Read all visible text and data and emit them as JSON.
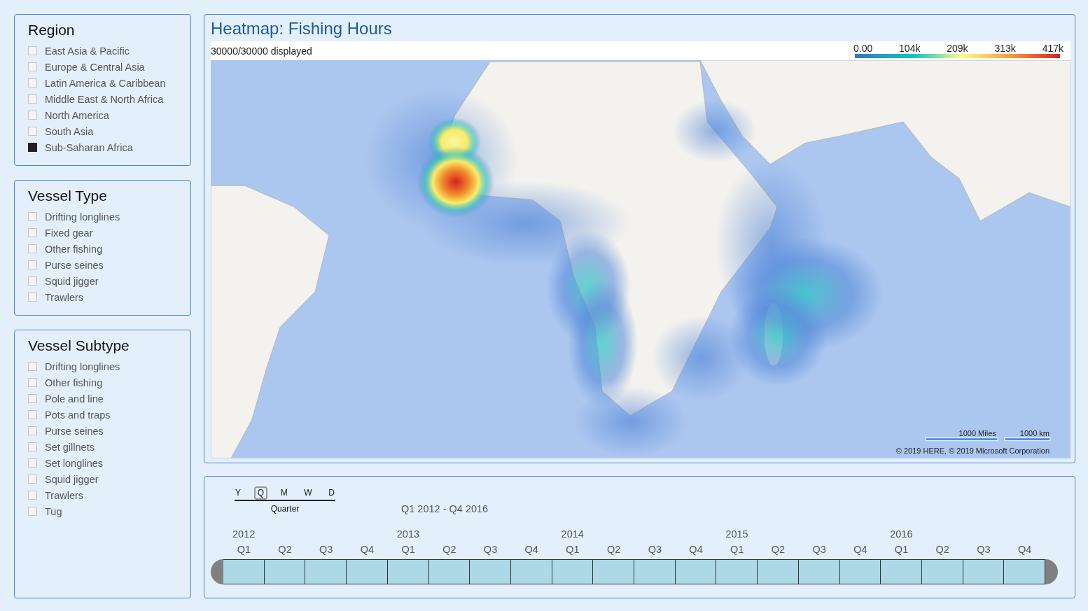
{
  "filters": [
    {
      "title": "Region",
      "items": [
        {
          "label": "East Asia & Pacific",
          "checked": false
        },
        {
          "label": "Europe & Central Asia",
          "checked": false
        },
        {
          "label": "Latin America & Caribbean",
          "checked": false
        },
        {
          "label": "Middle East & North Africa",
          "checked": false
        },
        {
          "label": "North America",
          "checked": false
        },
        {
          "label": "South Asia",
          "checked": false
        },
        {
          "label": "Sub-Saharan Africa",
          "checked": true
        }
      ]
    },
    {
      "title": "Vessel Type",
      "items": [
        {
          "label": "Drifting longlines",
          "checked": false
        },
        {
          "label": "Fixed gear",
          "checked": false
        },
        {
          "label": "Other fishing",
          "checked": false
        },
        {
          "label": "Purse seines",
          "checked": false
        },
        {
          "label": "Squid jigger",
          "checked": false
        },
        {
          "label": "Trawlers",
          "checked": false
        }
      ]
    },
    {
      "title": "Vessel Subtype",
      "items": [
        {
          "label": "Drifting longlines",
          "checked": false
        },
        {
          "label": "Other fishing",
          "checked": false
        },
        {
          "label": "Pole and line",
          "checked": false
        },
        {
          "label": "Pots and traps",
          "checked": false
        },
        {
          "label": "Purse seines",
          "checked": false
        },
        {
          "label": "Set gillnets",
          "checked": false
        },
        {
          "label": "Set longlines",
          "checked": false
        },
        {
          "label": "Squid jigger",
          "checked": false
        },
        {
          "label": "Trawlers",
          "checked": false
        },
        {
          "label": "Tug",
          "checked": false
        }
      ]
    }
  ],
  "map": {
    "title": "Heatmap: Fishing Hours",
    "count": "30000/30000 displayed",
    "legend": [
      "0.00",
      "104k",
      "209k",
      "313k",
      "417k"
    ],
    "scale": [
      "1000 Miles",
      "1000 km"
    ],
    "copyright": "© 2019 HERE, © 2019 Microsoft Corporation"
  },
  "timeline": {
    "granularity": [
      {
        "label": "Y",
        "selected": false
      },
      {
        "label": "Q",
        "selected": true
      },
      {
        "label": "M",
        "selected": false
      },
      {
        "label": "W",
        "selected": false
      },
      {
        "label": "D",
        "selected": false
      }
    ],
    "granularity_label": "Quarter",
    "range": "Q1 2012 - Q4 2016",
    "years": [
      {
        "year": "2012",
        "quarters": [
          {
            "label": "Q1",
            "selected": true
          },
          {
            "label": "Q2",
            "selected": true
          },
          {
            "label": "Q3",
            "selected": true
          },
          {
            "label": "Q4",
            "selected": true
          }
        ]
      },
      {
        "year": "2013",
        "quarters": [
          {
            "label": "Q1",
            "selected": true
          },
          {
            "label": "Q2",
            "selected": true
          },
          {
            "label": "Q3",
            "selected": true
          },
          {
            "label": "Q4",
            "selected": true
          }
        ]
      },
      {
        "year": "2014",
        "quarters": [
          {
            "label": "Q1",
            "selected": true
          },
          {
            "label": "Q2",
            "selected": true
          },
          {
            "label": "Q3",
            "selected": true
          },
          {
            "label": "Q4",
            "selected": true
          }
        ]
      },
      {
        "year": "2015",
        "quarters": [
          {
            "label": "Q1",
            "selected": true
          },
          {
            "label": "Q2",
            "selected": true
          },
          {
            "label": "Q3",
            "selected": true
          },
          {
            "label": "Q4",
            "selected": true
          }
        ]
      },
      {
        "year": "2016",
        "quarters": [
          {
            "label": "Q1",
            "selected": true
          },
          {
            "label": "Q2",
            "selected": true
          },
          {
            "label": "Q3",
            "selected": true
          },
          {
            "label": "Q4",
            "selected": true
          }
        ]
      }
    ]
  }
}
